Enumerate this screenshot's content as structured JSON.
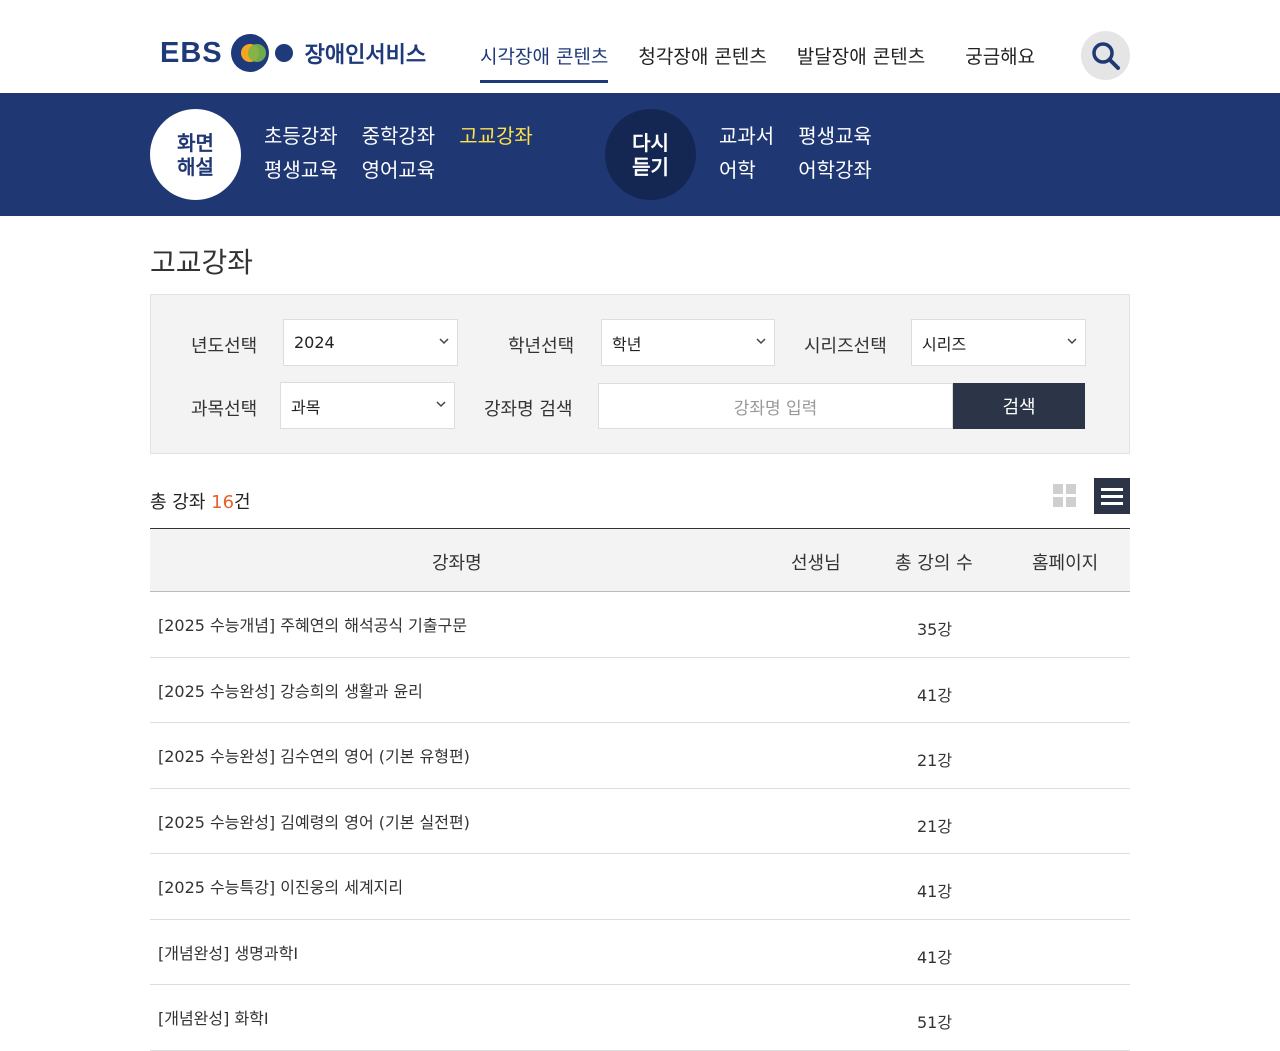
{
  "header": {
    "logo_ebs": "EBS",
    "logo_text": "장애인서비스",
    "nav": [
      {
        "label": "시각장애 콘텐츠"
      },
      {
        "label": "청각장애 콘텐츠"
      },
      {
        "label": "발달장애 콘텐츠"
      },
      {
        "label": "궁금해요"
      }
    ]
  },
  "band": {
    "circle_a": "화면\n해설",
    "circle_a_l1": "화면",
    "circle_a_l2": "해설",
    "links_a": [
      "초등강좌",
      "중학강좌",
      "고교강좌",
      "평생교육",
      "영어교육"
    ],
    "circle_b_l1": "다시",
    "circle_b_l2": "듣기",
    "links_b": [
      "교과서",
      "평생교육",
      "어학",
      "어학강좌"
    ]
  },
  "page": {
    "title": "고교강좌"
  },
  "filters": {
    "year_label": "년도선택",
    "year_value": "2024",
    "grade_label": "학년선택",
    "grade_value": "학년",
    "series_label": "시리즈선택",
    "series_value": "시리즈",
    "subject_label": "과목선택",
    "subject_value": "과목",
    "search_label": "강좌명 검색",
    "search_placeholder": "강좌명 입력",
    "search_button": "검색"
  },
  "total": {
    "prefix": "총 강좌 ",
    "count": "16",
    "suffix": "건"
  },
  "table": {
    "headers": {
      "title": "강좌명",
      "teacher": "선생님",
      "count": "총 강의 수",
      "homepage": "홈페이지"
    },
    "rows": [
      {
        "title": "[2025 수능개념] 주혜연의 해석공식 기출구문",
        "count": "35강"
      },
      {
        "title": "[2025 수능완성] 강승희의 생활과 윤리",
        "count": "41강"
      },
      {
        "title": "[2025 수능완성] 김수연의 영어 (기본 유형편)",
        "count": "21강"
      },
      {
        "title": "[2025 수능완성] 김예령의 영어 (기본 실전편)",
        "count": "21강"
      },
      {
        "title": "[2025 수능특강] 이진웅의 세계지리",
        "count": "41강"
      },
      {
        "title": "[개념완성] 생명과학Ⅰ",
        "count": "41강"
      },
      {
        "title": "[개념완성] 화학Ⅰ",
        "count": "51강"
      }
    ]
  }
}
